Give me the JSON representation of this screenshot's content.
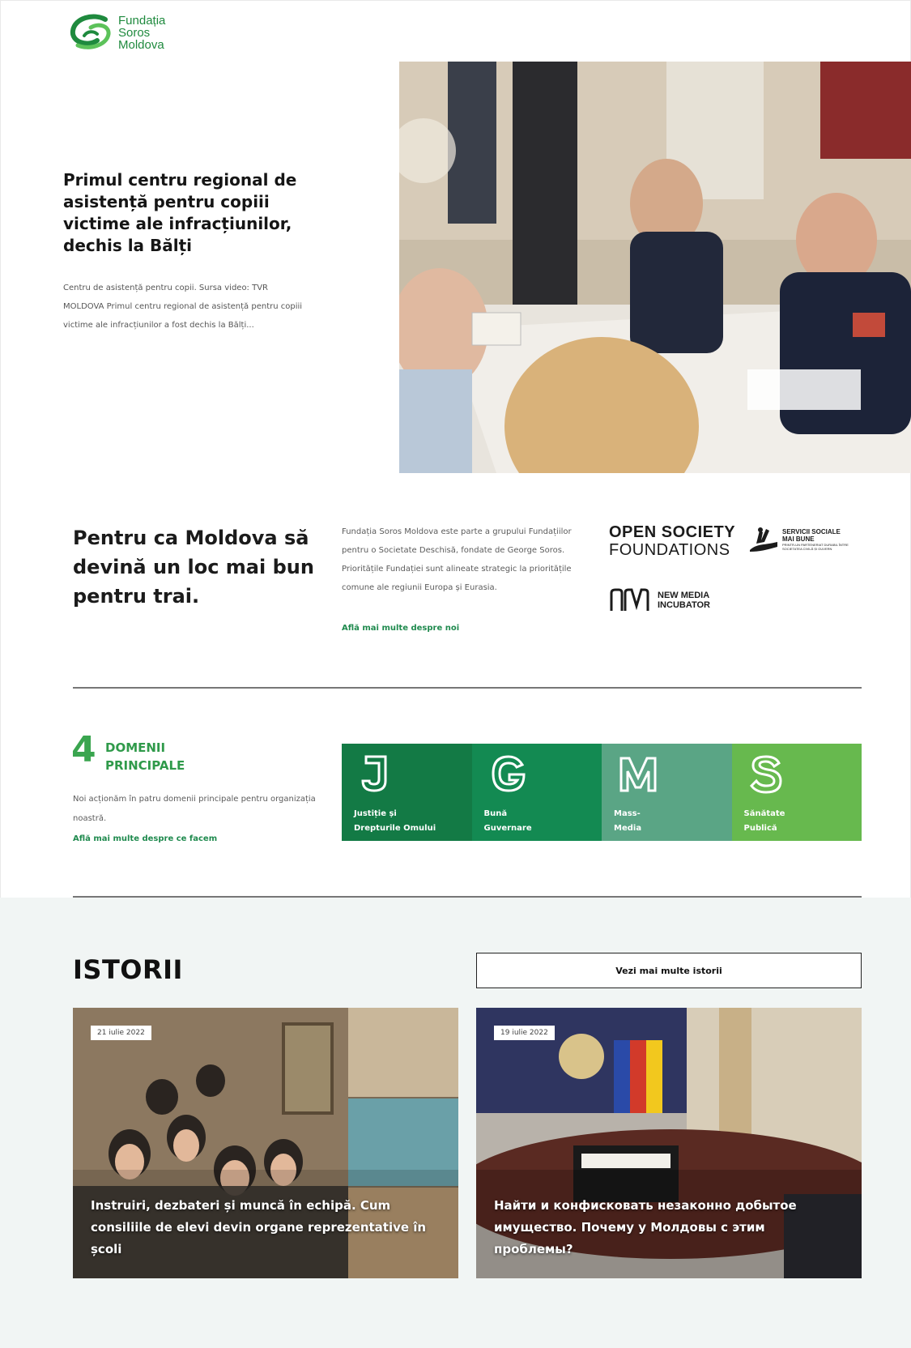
{
  "logo": {
    "line1": "Fundația",
    "line2": "Soros",
    "line3": "Moldova"
  },
  "hero": {
    "title": "Primul centru regional de asistență pentru copiii victime ale infracțiunilor, dechis la Bălți",
    "description": "Centru de asistență pentru copii. Sursa video: TVR MOLDOVA Primul centru regional de asistență pentru copiii victime ale infracțiunilor a fost dechis la Bălți..."
  },
  "about": {
    "title": "Pentru ca Moldova să devină un loc mai bun pentru trai.",
    "description": "Fundația Soros Moldova este parte a grupului Fundațiilor pentru o Societate Deschisă, fondate de George Soros. Prioritățile Fundației sunt alineate strategic la prioritățile comune ale regiunii Europa și Eurasia.",
    "link": "Află mai multe despre noi",
    "partners": {
      "osf_line1": "OPEN SOCIETY",
      "osf_line2": "FOUNDATIONS",
      "ssmb_line1": "SERVICII SOCIALE",
      "ssmb_line2": "MAI BUNE",
      "ssmb_sub": "PRINTR-UN PARTENERIAT DURABIL ÎNTRE SOCIETATEA CIVILĂ ȘI GUVERN",
      "nmi_line1": "NEW MEDIA",
      "nmi_line2": "INCUBATOR"
    }
  },
  "domains": {
    "number": "4",
    "heading_line1": "DOMENII",
    "heading_line2": "PRINCIPALE",
    "description": "Noi acționăm în patru domenii principale pentru organizația noastră.",
    "link": "Află mai multe despre ce facem",
    "tiles": [
      {
        "letter": "J",
        "line1": "Justiție și",
        "line2": "Drepturile Omului",
        "color": "#137a45"
      },
      {
        "letter": "G",
        "line1": "Bună",
        "line2": "Guvernare",
        "color": "#138a52"
      },
      {
        "letter": "M",
        "line1": "Mass-",
        "line2": "Media",
        "color": "#5aa585"
      },
      {
        "letter": "S",
        "line1": "Sănătate",
        "line2": "Publică",
        "color": "#67b94e"
      }
    ]
  },
  "stories": {
    "title": "ISTORII",
    "more_button": "Vezi mai multe istorii",
    "items": [
      {
        "date": "21 iulie 2022",
        "title": "Instruiri, dezbateri și muncă în echipă. Cum consiliile de elevi devin organe reprezentative în școli"
      },
      {
        "date": "19 iulie 2022",
        "title": "Найти и конфисковать незаконно добытое имущество. Почему у Молдовы с этим проблемы?"
      }
    ]
  },
  "colors": {
    "brand_green": "#1f8a3e",
    "link_green": "#1f8a4e",
    "stories_bg": "#f1f5f4"
  }
}
